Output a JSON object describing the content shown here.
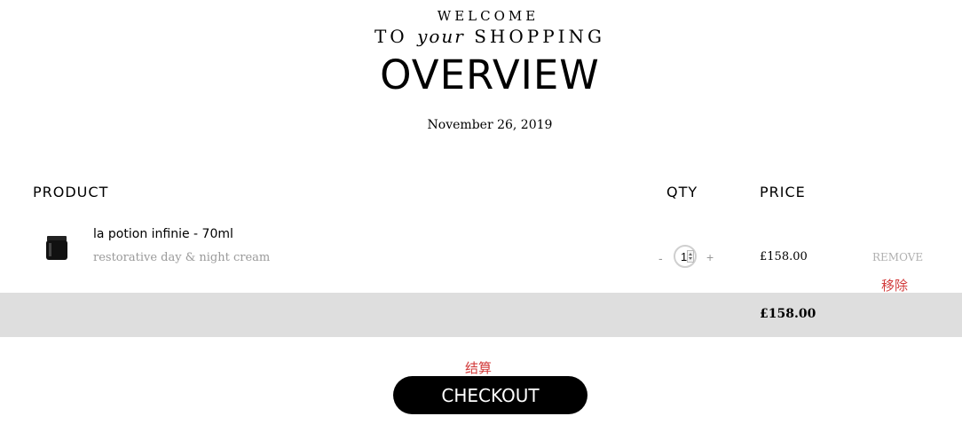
{
  "header": {
    "welcome": "WELCOME",
    "to": "TO",
    "your": "your",
    "shopping": "SHOPPING",
    "title": "OVERVIEW",
    "date": "November 26, 2019"
  },
  "table": {
    "headers": {
      "product": "PRODUCT",
      "qty": "QTY",
      "price": "PRICE"
    },
    "rows": [
      {
        "name": "la potion infinie - 70ml",
        "subtitle": "restorative day & night cream",
        "qty_minus": "-",
        "qty": "1",
        "qty_plus": "+",
        "price": "£158.00",
        "remove": "REMOVE",
        "remove_note": "移除"
      }
    ],
    "total": "£158.00"
  },
  "checkout": {
    "note": "结算",
    "label": "CHECKOUT"
  },
  "colors": {
    "accent": "#000000",
    "annotation": "#d23b3b",
    "total_bar": "#dedede"
  }
}
